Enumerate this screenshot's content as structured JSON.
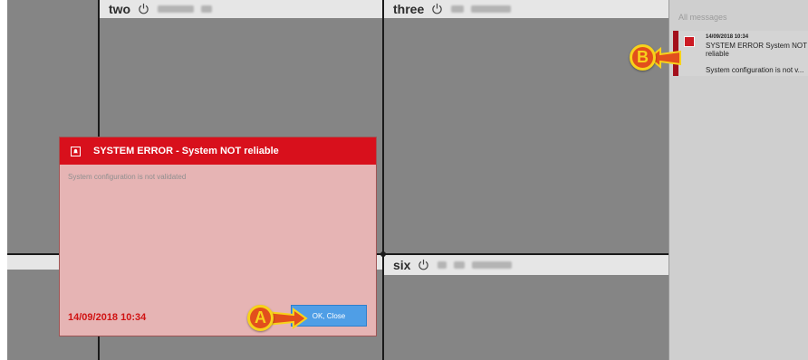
{
  "cells": {
    "two": {
      "name": "two"
    },
    "three": {
      "name": "three"
    },
    "six": {
      "name": "six"
    }
  },
  "right_panel": {
    "title": "All messages",
    "message": {
      "timestamp": "14/09/2018 10:34",
      "title": "SYSTEM ERROR System NOT reliable",
      "detail": "System configuration is not v..."
    }
  },
  "dialog": {
    "title": "SYSTEM ERROR - System NOT reliable",
    "body": "System configuration is not validated",
    "date": "14/09/2018 10:34",
    "ok_label": "OK, Close"
  },
  "callouts": {
    "a": "A",
    "b": "B"
  },
  "colors": {
    "alarm_red": "#d8101c",
    "dialog_bg": "#e6b4b4",
    "button_blue": "#4f9ee6",
    "callout_orange": "#e24f1c",
    "callout_yellow": "#f7d21b"
  }
}
